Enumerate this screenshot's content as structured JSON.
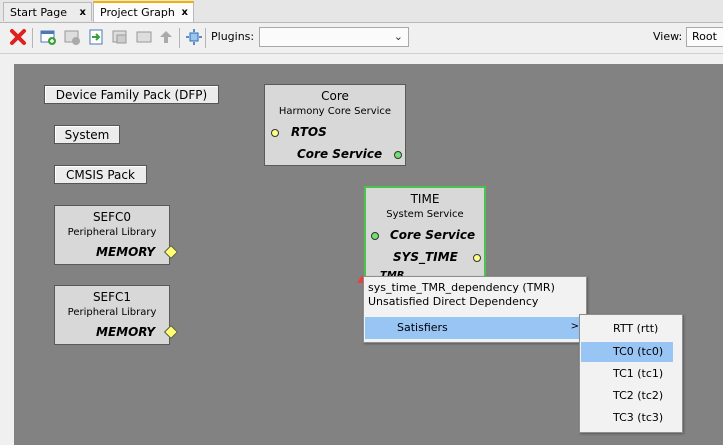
{
  "tabs": [
    {
      "label": "Start Page",
      "close": "x"
    },
    {
      "label": "Project Graph",
      "close": "x"
    }
  ],
  "toolbar": {
    "plugins_label": "Plugins:",
    "plugins_value": "",
    "view_label": "View:",
    "view_value": "Root",
    "icons": [
      "delete-icon",
      "add-component-icon",
      "remove-component-icon",
      "import-icon",
      "export-icon",
      "group-icon",
      "move-up-icon",
      "fit-view-icon"
    ]
  },
  "canvas": {
    "pills": [
      {
        "label": "Device Family Pack (DFP)"
      },
      {
        "label": "System"
      },
      {
        "label": "CMSIS Pack"
      }
    ],
    "nodes": {
      "core": {
        "title": "Core",
        "subtitle": "Harmony Core Service",
        "port1": "RTOS",
        "port2": "Core Service"
      },
      "time": {
        "title": "TIME",
        "subtitle": "System Service",
        "port1": "Core Service",
        "port2": "SYS_TIME",
        "port3": "TMR"
      },
      "sefc0": {
        "title": "SEFC0",
        "subtitle": "Peripheral Library",
        "port1": "MEMORY"
      },
      "sefc1": {
        "title": "SEFC1",
        "subtitle": "Peripheral Library",
        "port1": "MEMORY"
      }
    }
  },
  "popup": {
    "line1": "sys_time_TMR_dependency (TMR)",
    "line2": "Unsatisfied Direct Dependency",
    "satisfiers_label": "Satisfiers",
    "arrow": ">"
  },
  "submenu": {
    "items": [
      "RTT (rtt)",
      "TC0 (tc0)",
      "TC1 (tc1)",
      "TC2 (tc2)",
      "TC3 (tc3)"
    ]
  },
  "colors": {
    "canvas": "#828282",
    "highlight": "#99c5f5",
    "selected_border": "#4cc34c",
    "delete_red": "#e02020"
  }
}
